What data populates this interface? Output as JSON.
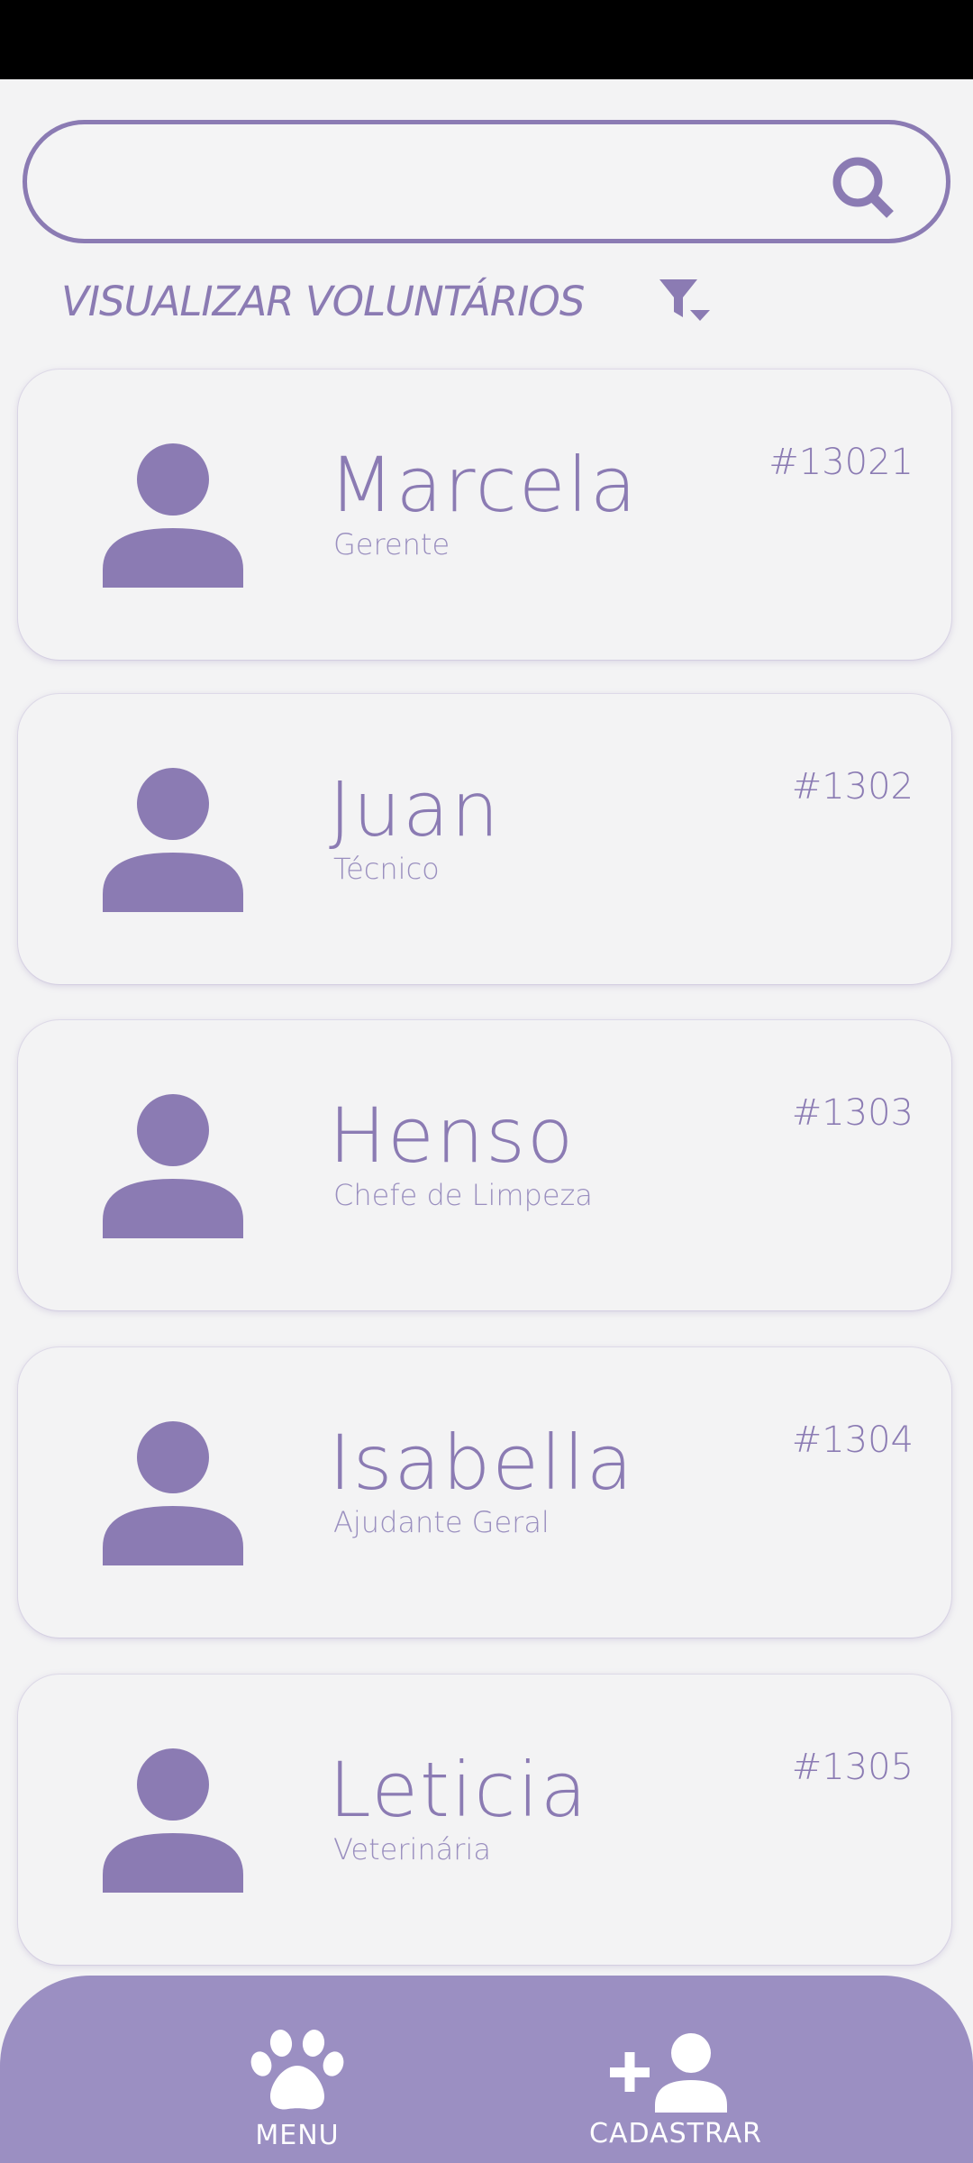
{
  "search": {
    "value": "",
    "placeholder": ""
  },
  "header": {
    "title": "VISUALIZAR VOLUNTÁRIOS"
  },
  "volunteers": [
    {
      "name": "Marcela",
      "role": "Gerente",
      "id": "#13021"
    },
    {
      "name": "Juan",
      "role": "Técnico",
      "id": "#1302"
    },
    {
      "name": "Henso",
      "role": "Chefe de Limpeza",
      "id": "#1303"
    },
    {
      "name": "Isabella",
      "role": "Ajudante Geral",
      "id": "#1304"
    },
    {
      "name": "Leticia",
      "role": "Veterinária",
      "id": "#1305"
    }
  ],
  "nav": {
    "menu": {
      "label": "MENU",
      "icon": "paw-icon"
    },
    "register": {
      "label": "CADASTRAR",
      "icon": "add-user-icon"
    }
  },
  "colors": {
    "accent": "#8b7bb3",
    "nav_background": "#9b8fc2",
    "background": "#f3f3f4",
    "status_bar": "#000000"
  }
}
